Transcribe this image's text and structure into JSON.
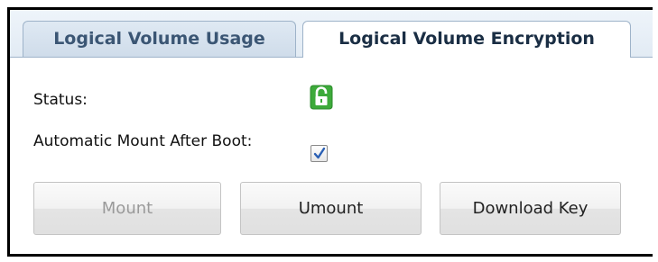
{
  "tabs": [
    {
      "label": "Logical Volume Usage",
      "active": false
    },
    {
      "label": "Logical Volume Encryption",
      "active": true
    }
  ],
  "form": {
    "status_label": "Status:",
    "status_icon": "unlocked-lock-icon",
    "status_icon_color": "#3daa3a",
    "automount_label": "Automatic Mount After Boot:",
    "automount_checked": true
  },
  "buttons": {
    "mount": {
      "label": "Mount",
      "disabled": true
    },
    "umount": {
      "label": "Umount",
      "disabled": false
    },
    "download_key": {
      "label": "Download Key",
      "disabled": false
    }
  }
}
